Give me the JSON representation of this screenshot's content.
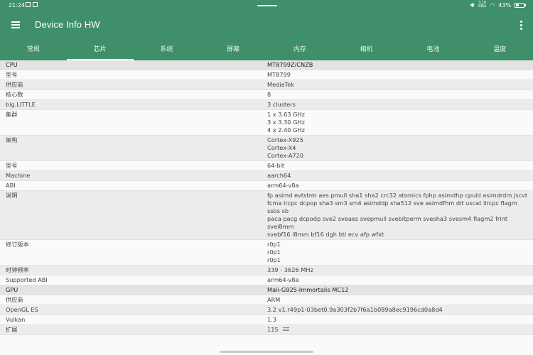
{
  "status_bar": {
    "time": "21:24",
    "net_speed_value": "3.10",
    "net_speed_unit": "KB/s",
    "battery_text": "43%",
    "battery_level": 0.43
  },
  "toolbar": {
    "title": "Device Info HW"
  },
  "tabs": [
    {
      "label": "常规",
      "active": false
    },
    {
      "label": "芯片",
      "active": true
    },
    {
      "label": "系统",
      "active": false
    },
    {
      "label": "屏幕",
      "active": false
    },
    {
      "label": "内存",
      "active": false
    },
    {
      "label": "相机",
      "active": false
    },
    {
      "label": "电池",
      "active": false
    },
    {
      "label": "温度",
      "active": false
    }
  ],
  "rows": [
    {
      "key": "CPU",
      "value": "MT8799Z/CNZB",
      "section": true
    },
    {
      "key": "型号",
      "value": "MT8799"
    },
    {
      "key": "供应商",
      "value": "MediaTek"
    },
    {
      "key": "核心数",
      "value": "8"
    },
    {
      "key": "big.LITTLE",
      "value": "3 clusters"
    },
    {
      "key": "集群",
      "value": "1 x 3.63 GHz\n3 x 3.30 GHz\n4 x 2.40 GHz"
    },
    {
      "key": "架构",
      "value": "Cortex-X925\nCortex-X4\nCortex-A720"
    },
    {
      "key": "型号",
      "value": "64-bit"
    },
    {
      "key": "Machine",
      "value": "aarch64"
    },
    {
      "key": "ABI",
      "value": "arm64-v8a"
    },
    {
      "key": "说明",
      "value": "fp asimd evtstrm aes pmull sha1 sha2 crc32 atomics fphp asimdhp cpuid asimdrdm jscvt\nfcma lrcpc dcpop sha3 sm3 sm4 asimddp sha512 sve asimdfhm dit uscat ilrcpc flagm ssbs sb\npaca pacg dcpodp sve2 sveaes svepmull svebitperm svesha3 svesm4 flagm2 frint svei8mm\nsvebf16 i8mm bf16 dgh bti ecv afp wfxt"
    },
    {
      "key": "修订版本",
      "value": "r0p1\nr0p1\nr0p1"
    },
    {
      "key": "时钟频率",
      "value": "339 - 3626 MHz"
    },
    {
      "key": "Supported ABI",
      "value": "arm64-v8a"
    },
    {
      "key": "GPU",
      "value": "Mali-G925-Immortalis MC12",
      "section": true
    },
    {
      "key": "供应商",
      "value": "ARM"
    },
    {
      "key": "OpenGL ES",
      "value": "3.2 v1.r49p1-03bet0.9a303f2b7f6a1b089a8ec9196cd0a8d4"
    },
    {
      "key": "Vulkan",
      "value": "1.3"
    },
    {
      "key": "扩展",
      "value": "115",
      "expand_icon": "list-icon"
    }
  ],
  "colors": {
    "appbar": "#3f8f6a",
    "row_odd": "#ececec",
    "row_even": "#fafafa"
  }
}
